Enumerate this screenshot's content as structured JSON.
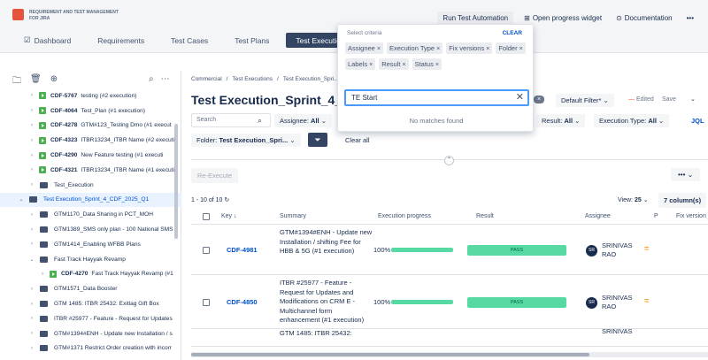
{
  "app": {
    "title_line1": "REQUIREMENT AND TEST MANAGEMENT",
    "title_line2": "FOR JIRA"
  },
  "nav": {
    "dashboard": "Dashboard",
    "requirements": "Requirements",
    "test_cases": "Test Cases",
    "test_plans": "Test Plans",
    "test_executions": "Test Executions"
  },
  "top_actions": {
    "run": "Run Test Automation",
    "progress": "Open progress widget",
    "docs": "Documentation",
    "more": "•••"
  },
  "tree": [
    {
      "level": 2,
      "type": "exec",
      "key": "CDF-5767",
      "label": "testing (#2 execution)"
    },
    {
      "level": 2,
      "type": "exec",
      "key": "CDF-4064",
      "label": "Test_Plan (#1 execution)"
    },
    {
      "level": 2,
      "type": "exec",
      "key": "CDF-4278",
      "label": "GTM#123_Testing Dmo (#1 execut"
    },
    {
      "level": 2,
      "type": "exec",
      "key": "CDF-4323",
      "label": "ITBR13234_ITBR Name (#2 executi"
    },
    {
      "level": 2,
      "type": "exec",
      "key": "CDF-4290",
      "label": "New Feature testing (#1 executi"
    },
    {
      "level": 2,
      "type": "exec",
      "key": "CDF-4321",
      "label": "ITBR13234_ITBR Name (#1 executi"
    },
    {
      "level": 2,
      "type": "folder",
      "key": "",
      "label": "Test_Execution"
    },
    {
      "level": 1,
      "type": "folder",
      "key": "",
      "label": "Test Execution_Sprint_4_CDF_2025_Q1",
      "selected": true,
      "open": true
    },
    {
      "level": 2,
      "type": "folder",
      "key": "",
      "label": "GTM1170_Data Sharing in PCT_MOH"
    },
    {
      "level": 2,
      "type": "folder",
      "key": "",
      "label": "GTM1389_SMS only plan - 100 National SMS"
    },
    {
      "level": 2,
      "type": "folder",
      "key": "",
      "label": "GTM1414_Enabling WFBB Plans"
    },
    {
      "level": 2,
      "type": "folder",
      "key": "",
      "label": "Fast Track Hayyak Revamp",
      "open": true
    },
    {
      "level": 3,
      "type": "exec",
      "key": "CDF-4270",
      "label": "Fast Track Hayyak Revamp (#1"
    },
    {
      "level": 2,
      "type": "folder",
      "key": "",
      "label": "GTM1571_Data Booster"
    },
    {
      "level": 2,
      "type": "folder",
      "key": "",
      "label": "GTM 1485: ITBR 25432: Exitlag Gift Box"
    },
    {
      "level": 2,
      "type": "folder",
      "key": "",
      "label": "ITBR #25977 - Feature - Request for Updates"
    },
    {
      "level": 2,
      "type": "folder",
      "key": "",
      "label": "GTM#1394#ENH - Update new Installation / s"
    },
    {
      "level": 2,
      "type": "folder",
      "key": "",
      "label": "GTM#1371 Restrict Order creation with incorr"
    }
  ],
  "breadcrumb": {
    "b1": "Commercial",
    "b2": "Test Executions",
    "b3": "Test Execution_Spri..."
  },
  "page": {
    "title": "Test Execution_Sprint_4_CDF",
    "close": "×",
    "default_filter": "Default Filter* ⌄",
    "edited": "Edited",
    "save": "Save",
    "caret": "⌄"
  },
  "filters": {
    "search_placeholder": "Search",
    "assignee": "Assignee:",
    "assignee_v": "All",
    "result": "Result:",
    "result_v": "All",
    "exec_type": "Execution Type:",
    "exec_type_v": "All",
    "jql": "JQL",
    "folder": "Folder:",
    "folder_v": "Test Execution_Spri...",
    "clear_all": "Clear all"
  },
  "toolbar": {
    "reexecute": "Re-Execute",
    "more": "•••",
    "pager": "1 - 10 of 10",
    "view": "View:",
    "view_v": "25",
    "columns": "7 column(s)"
  },
  "table": {
    "headers": {
      "key": "Key ↓",
      "summary": "Summary",
      "progress": "Execution progress",
      "result": "Result",
      "assignee": "Assignee",
      "p": "P",
      "fix": "Fix version"
    },
    "rows": [
      {
        "key": "CDF-4981",
        "summary": "GTM#1394#ENH - Update new Installation / shifting Fee for HBB & 5G (#1 execution)",
        "progress_text": "100%",
        "progress": 1.0,
        "result": "PASS",
        "avatar": "SR",
        "assignee": "SRINIVAS RAO"
      },
      {
        "key": "CDF-4850",
        "summary": "ITBR #25977 - Feature - Request for Updates and Modifications on CRM E - Multichannel form enhancement (#1 execution)",
        "progress_text": "100%",
        "progress": 1.0,
        "result": "PASS",
        "avatar": "SR",
        "assignee": "SRINIVAS RAO"
      },
      {
        "key": "",
        "summary": "GTM 1485: ITBR 25432:",
        "progress_text": "",
        "progress": 0,
        "result": "",
        "avatar": "",
        "assignee": "SRINIVAS"
      }
    ]
  },
  "dropdown": {
    "label": "Select criteria",
    "clear": "CLEAR",
    "chips": [
      "Assignee",
      "Execution Type",
      "Fix versions",
      "Folder",
      "Labels",
      "Result",
      "Status"
    ],
    "input_value": "TE Start",
    "empty": "No matches found"
  },
  "colors": {
    "accent": "#344563",
    "pass": "#57d9a3",
    "link": "#0052cc",
    "priority": "#ff991f"
  }
}
